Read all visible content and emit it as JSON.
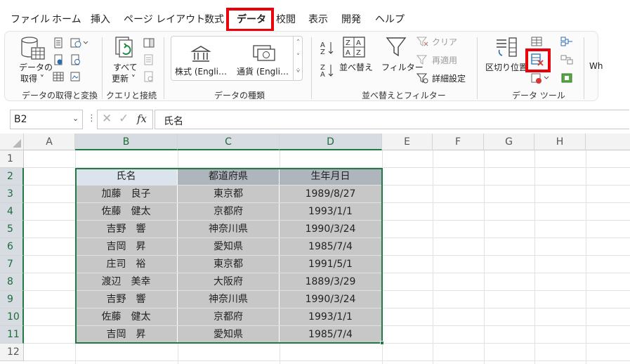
{
  "tabs": [
    "ファイル",
    "ホーム",
    "挿入",
    "ページ レイアウト",
    "数式",
    "データ",
    "校閲",
    "表示",
    "開発",
    "ヘルプ"
  ],
  "active_tab": "データ",
  "ribbon": {
    "get_data": {
      "line1": "データの",
      "line2": "取得 ˅",
      "group": "データの取得と変換"
    },
    "queries": {
      "line1": "すべて",
      "line2": "更新 ˅",
      "group": "クエリと接続"
    },
    "data_types": {
      "stocks": "株式 (Engli…",
      "currency": "通貨 (Engli…",
      "group": "データの種類"
    },
    "sort_filter": {
      "sort": "並べ替え",
      "filter": "フィルター",
      "clear": "クリア",
      "reapply": "再適用",
      "advanced": "詳細設定",
      "group": "並べ替えとフィルター"
    },
    "data_tools": {
      "text_to_columns": "区切り位置",
      "group": "データ ツール"
    },
    "whatif_cut": "Wh"
  },
  "formula_bar": {
    "name_box": "B2",
    "content": "氏名"
  },
  "columns": [
    "A",
    "B",
    "C",
    "D",
    "E",
    "F",
    "G",
    "H"
  ],
  "rows": [
    "1",
    "2",
    "3",
    "4",
    "5",
    "6",
    "7",
    "8",
    "9",
    "10",
    "11",
    "12"
  ],
  "table": {
    "headers": [
      "氏名",
      "都道府県",
      "生年月日"
    ],
    "rows": [
      [
        "加藤　良子",
        "東京都",
        "1989/8/27"
      ],
      [
        "佐藤　健太",
        "京都府",
        "1993/1/1"
      ],
      [
        "吉野　響",
        "神奈川県",
        "1990/3/24"
      ],
      [
        "吉岡　昇",
        "愛知県",
        "1985/7/4"
      ],
      [
        "庄司　裕",
        "東京都",
        "1991/5/1"
      ],
      [
        "渡辺　美幸",
        "大阪府",
        "1889/3/29"
      ],
      [
        "吉野　響",
        "神奈川県",
        "1990/3/24"
      ],
      [
        "佐藤　健太",
        "京都府",
        "1993/1/1"
      ],
      [
        "吉岡　昇",
        "愛知県",
        "1985/7/4"
      ]
    ]
  },
  "colors": {
    "accent_green": "#1f7a44",
    "highlight_red": "#e8000b",
    "header_fill": "#aeb5bd",
    "data_fill": "#c7c7c7"
  }
}
